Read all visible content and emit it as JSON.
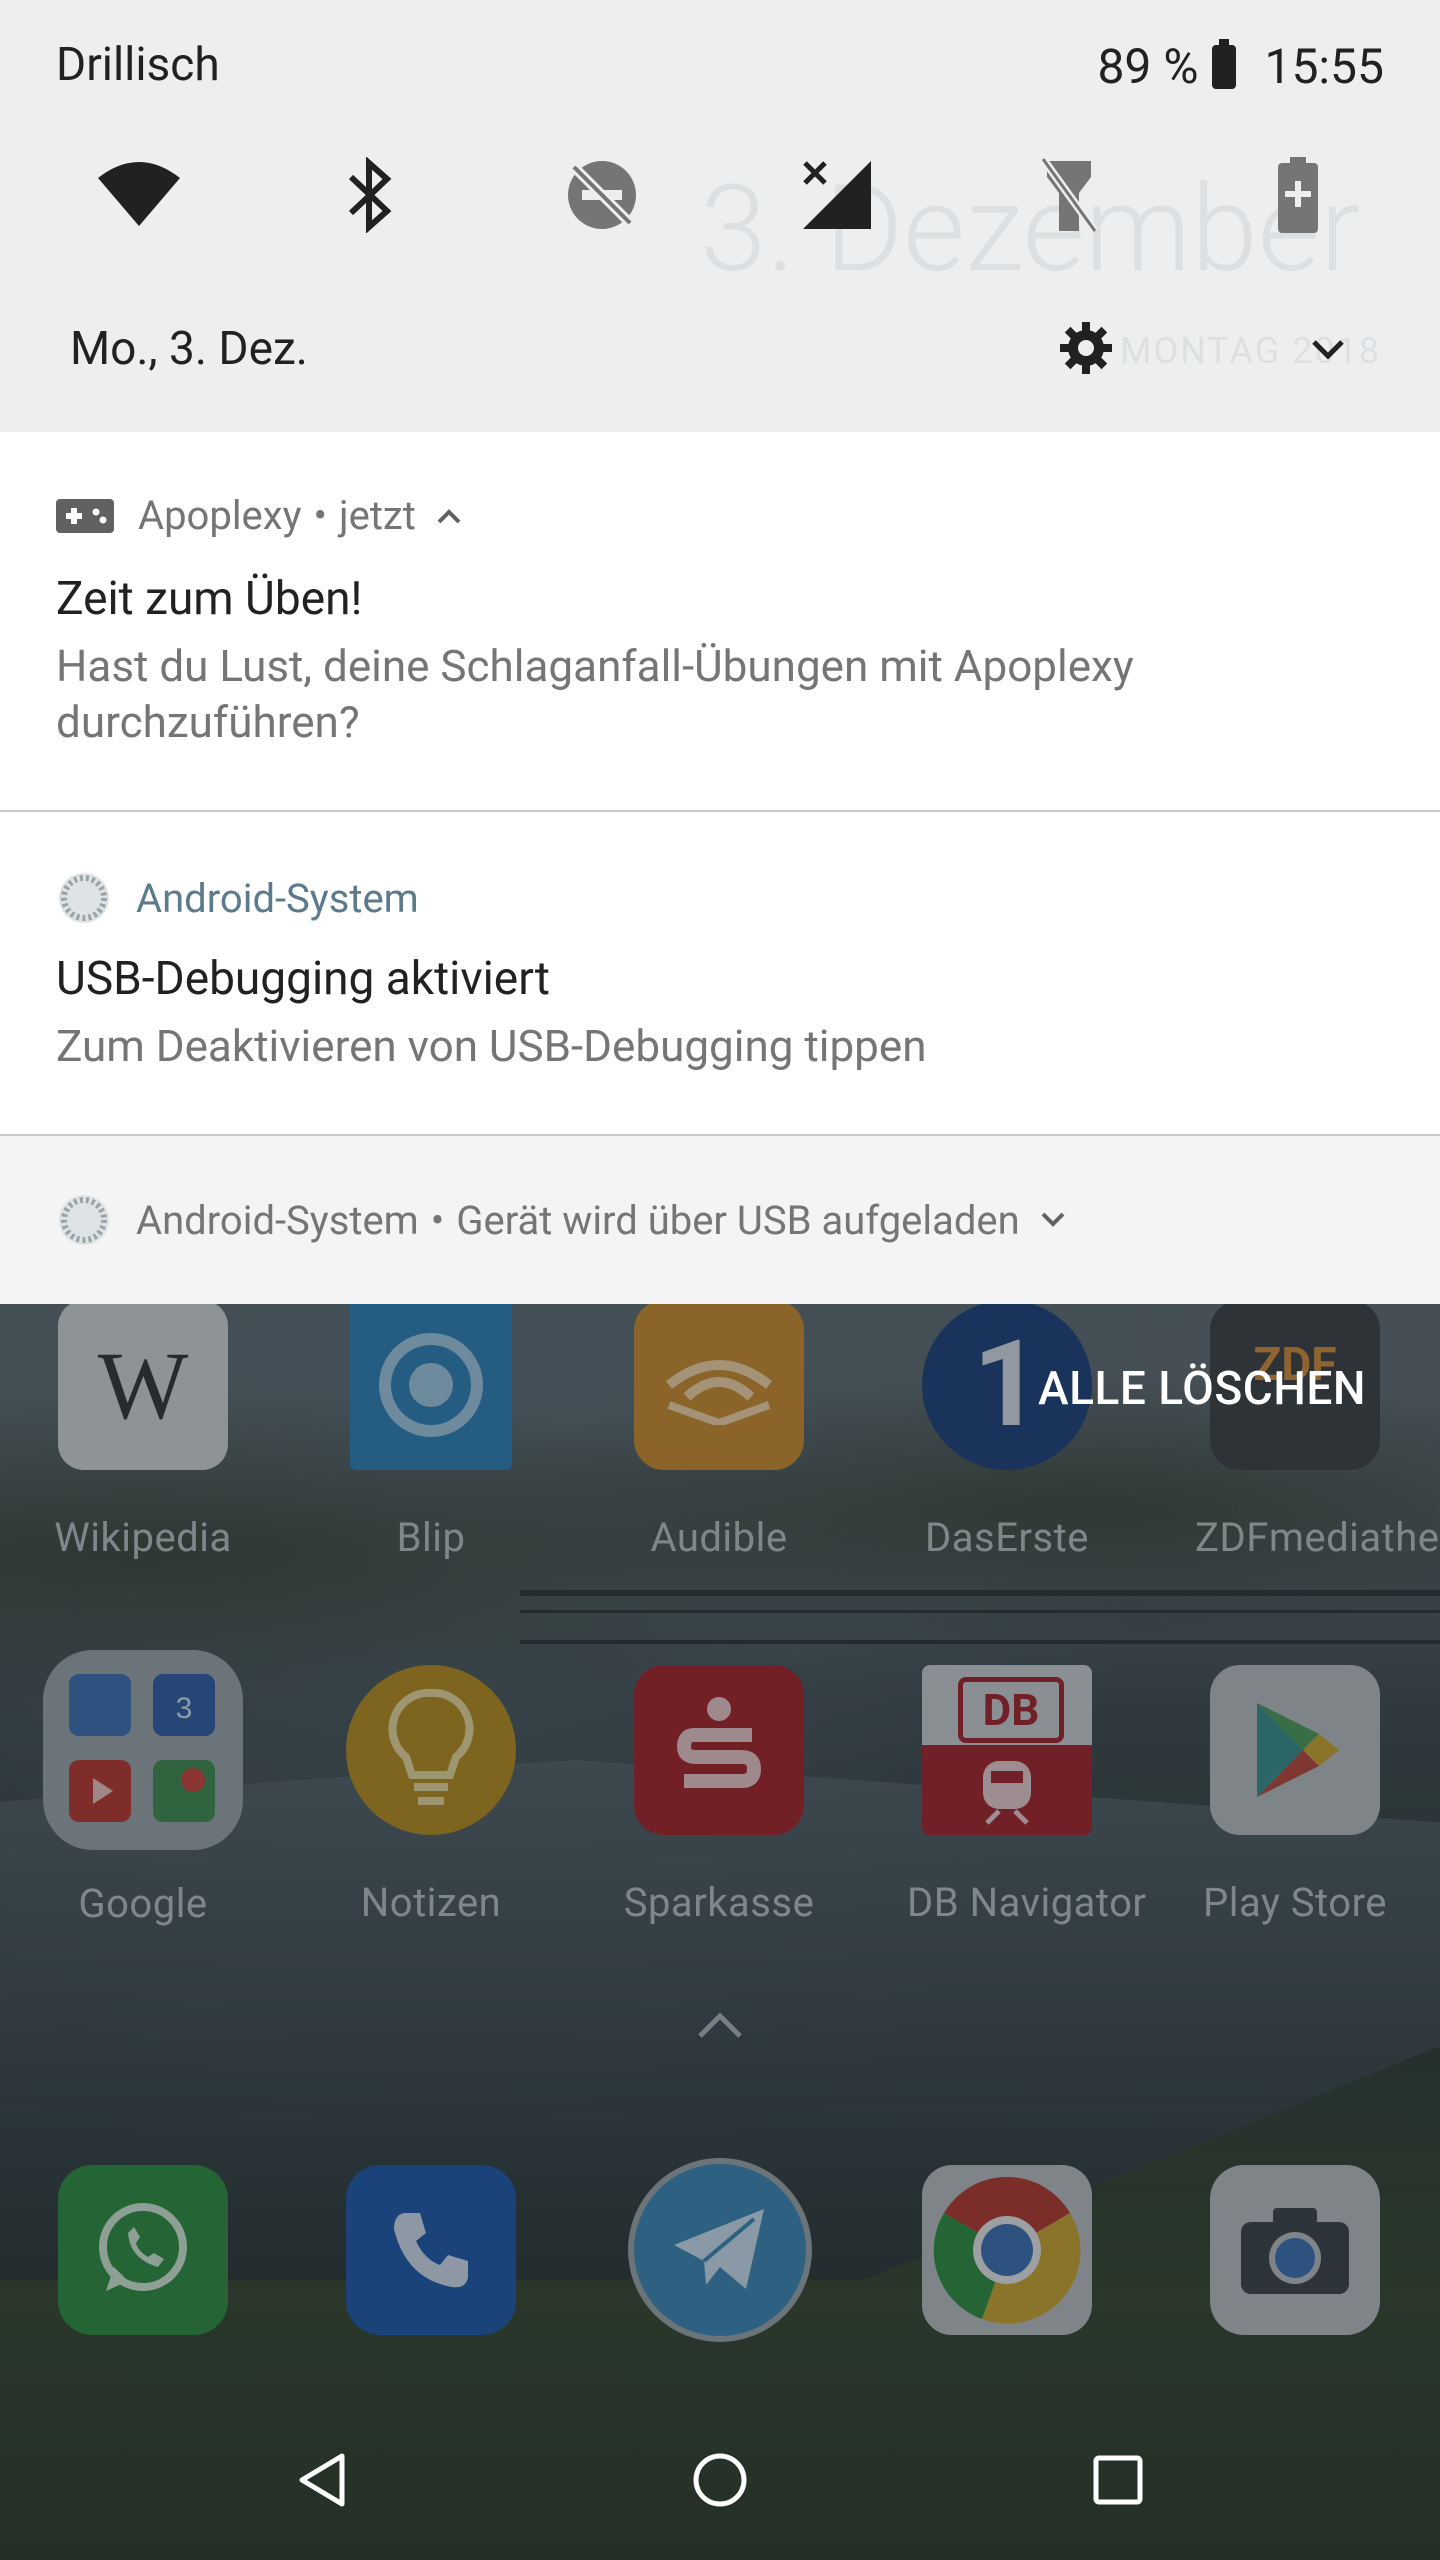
{
  "status_bar": {
    "carrier": "Drillisch",
    "battery": "89 %",
    "time": "15:55"
  },
  "quick_settings": {
    "background_date": "3. Dezember",
    "background_day": "MONTAG 2018",
    "date": "Mo., 3. Dez.",
    "tiles": [
      "wifi-icon",
      "bluetooth-icon",
      "dnd-off-icon",
      "mobile-data-off-icon",
      "flashlight-off-icon",
      "battery-saver-icon"
    ]
  },
  "notifications": [
    {
      "app": "Apoplexy",
      "time": "jetzt",
      "title": "Zeit zum Üben!",
      "text": "Hast du Lust, deine Schlaganfall-Übungen mit Apoplexy durchzuführen?"
    },
    {
      "app": "Android-System",
      "title": "USB-Debugging aktiviert",
      "text": "Zum Deaktivieren von USB-Debugging tippen"
    },
    {
      "app": "Android-System",
      "summary": "Gerät wird über USB aufgeladen"
    }
  ],
  "clear_all": "ALLE LÖSCHEN",
  "home_row1": [
    "Wikipedia",
    "Blip",
    "Audible",
    "DasErste",
    "ZDFmediathek"
  ],
  "home_row2": [
    "Google",
    "Notizen",
    "Sparkasse",
    "DB Navigator",
    "Play Store"
  ],
  "dock": [
    "whatsapp-icon",
    "phone-icon",
    "telegram-icon",
    "chrome-icon",
    "camera-icon"
  ],
  "colors": {
    "shade_bg": "#eceeef",
    "android_system": "#5b7a8c",
    "text_primary": "#212121",
    "text_secondary": "#757575"
  }
}
